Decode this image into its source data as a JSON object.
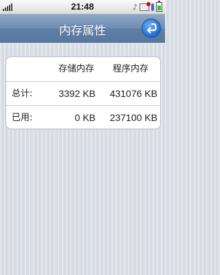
{
  "status_bar": {
    "time": "21:48",
    "icons": [
      "signal-icon",
      "music-note-icon",
      "mail-icon",
      "bluetooth-icon",
      "battery-icon"
    ]
  },
  "title_bar": {
    "title": "内存属性",
    "back_icon": "back-arrow-icon"
  },
  "memory_table": {
    "headers": [
      "",
      "存储内存",
      "程序内存"
    ],
    "rows": [
      {
        "label": "总计:",
        "storage": "3392 KB",
        "program": "431076 KB"
      },
      {
        "label": "已用:",
        "storage": "0 KB",
        "program": "237100 KB"
      }
    ]
  },
  "colors": {
    "title_bar": "#6e8db2",
    "back_button": "#1e6cd0",
    "background": "#d7dce3"
  }
}
